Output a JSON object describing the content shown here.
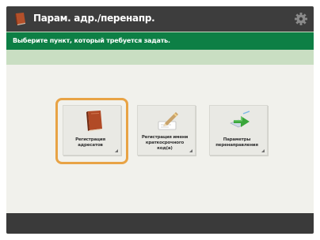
{
  "header": {
    "title": "Парам. адр./перенапр.",
    "app_icon": "book-icon",
    "settings_icon": "gear-icon"
  },
  "instruction": "Выберите пункт, который требуется задать.",
  "tiles": [
    {
      "label": "Регистрация\nадресатов",
      "icon": "address-book-icon",
      "selected": true
    },
    {
      "label": "Регистрация имени\nкраткосрочного\nкод(а)",
      "icon": "pen-edit-icon",
      "selected": false
    },
    {
      "label": "Параметры\nперенаправления",
      "icon": "forward-arrow-icon",
      "selected": false
    }
  ],
  "colors": {
    "title_bar": "#3d3d3d",
    "instruction_bar": "#0d7f45",
    "background": "#c9dec2",
    "panel": "#f1f1ec",
    "focus": "#e8a345"
  }
}
